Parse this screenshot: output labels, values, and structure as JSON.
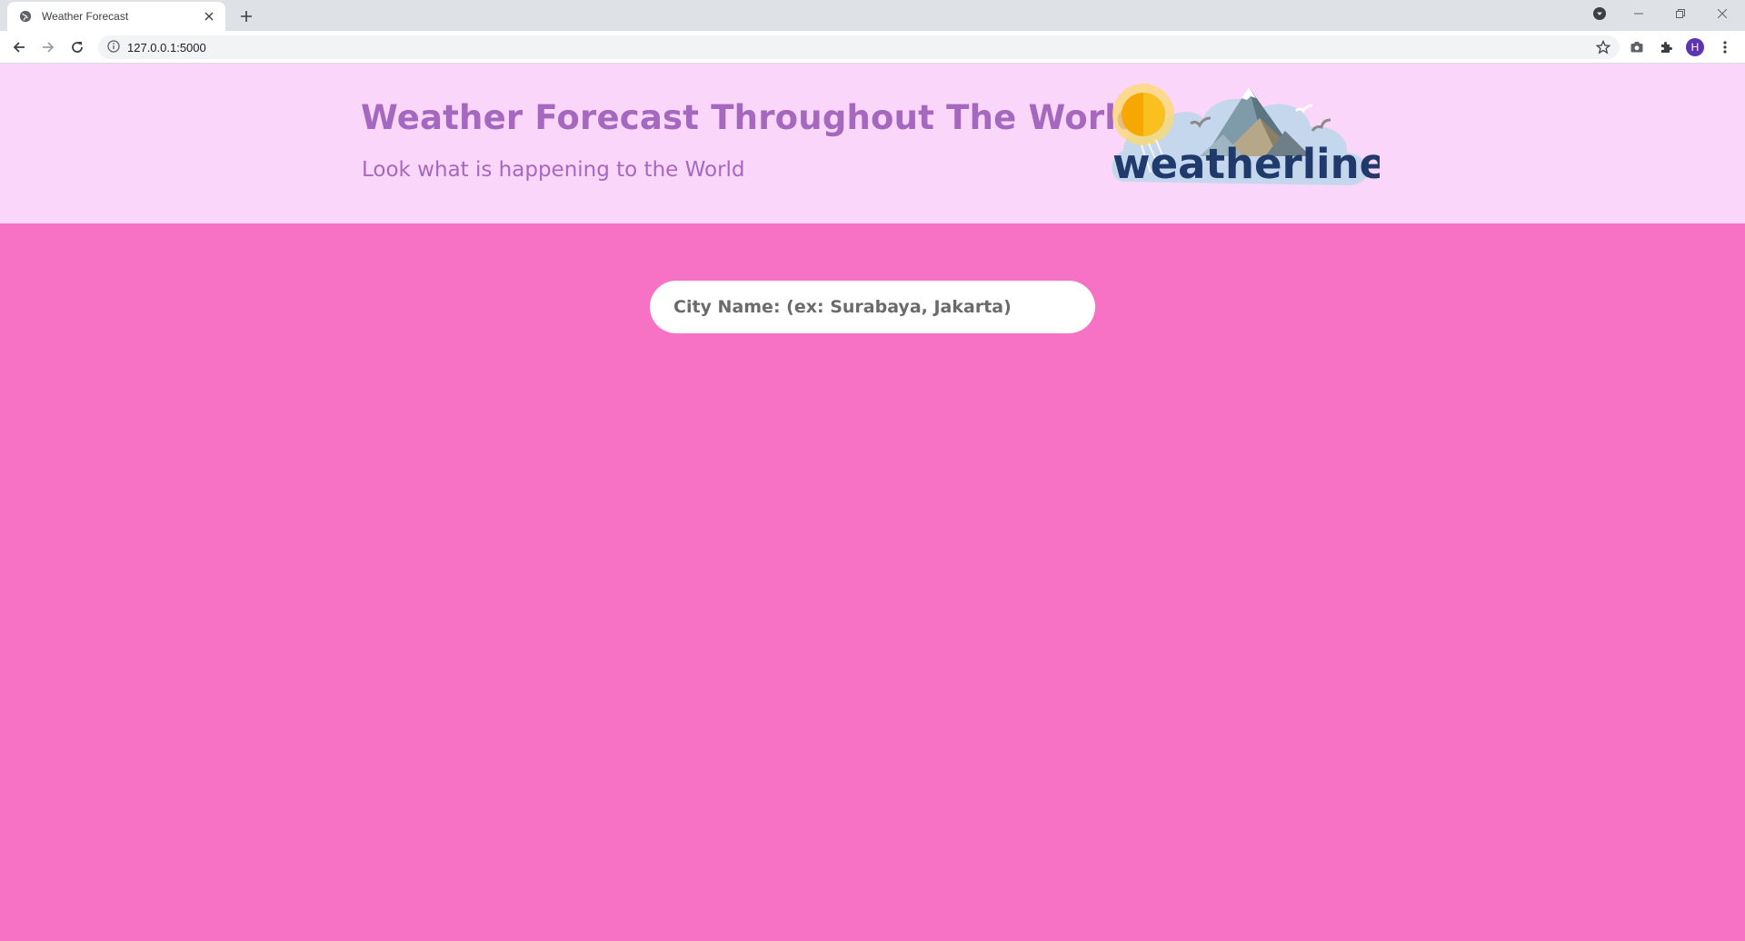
{
  "browser": {
    "tab_title": "Weather Forecast",
    "url": "127.0.0.1:5000",
    "profile_initial": "H"
  },
  "hero": {
    "title": "Weather Forecast Throughout The World",
    "subtitle": "Look what is happening to the World",
    "logo_text": "weatherline"
  },
  "search": {
    "placeholder": "City Name: (ex: Surabaya, Jakarta)"
  },
  "colors": {
    "page_background": "#f772c4",
    "hero_background": "#fad6fa",
    "accent_purple": "#a568bf",
    "logo_navy": "#1f3a6b"
  },
  "icons": [
    "globe-icon",
    "close-icon",
    "plus-icon",
    "back-arrow-icon",
    "forward-arrow-icon",
    "reload-icon",
    "info-icon",
    "star-icon",
    "camera-icon",
    "puzzle-icon",
    "kebab-menu-icon",
    "minimize-icon",
    "restore-icon",
    "window-close-icon",
    "media-control-icon"
  ]
}
